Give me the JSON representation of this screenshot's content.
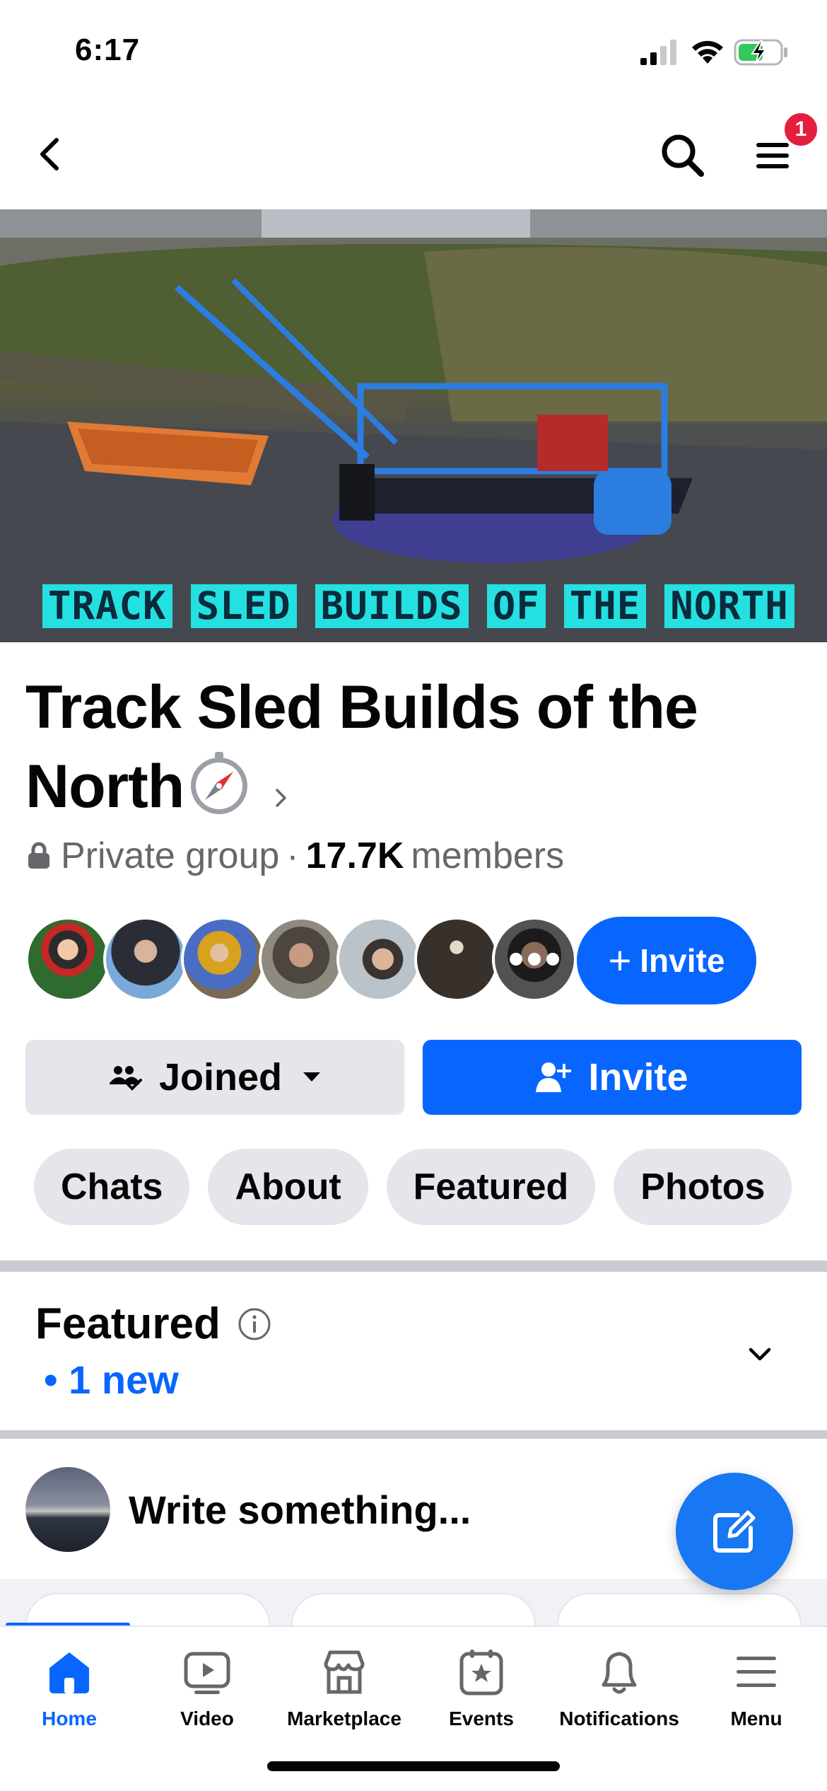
{
  "status_bar": {
    "time": "6:17",
    "icons": [
      "signal-icon",
      "wifi-icon",
      "battery-charging-icon"
    ]
  },
  "nav": {
    "icons": [
      "back-icon",
      "search-icon",
      "menu-icon"
    ],
    "menu_badge": "1"
  },
  "cover": {
    "caption_words": [
      "TRACK",
      "SLED",
      "BUILDS",
      "OF",
      "THE",
      "NORTH"
    ]
  },
  "group": {
    "title": "Track Sled Builds of the North",
    "title_emoji": "compass-icon",
    "privacy": "Private group",
    "separator": "·",
    "member_count": "17.7K",
    "members_label": "members"
  },
  "members": {
    "invite_label": "Invite"
  },
  "actions": {
    "joined_label": "Joined",
    "invite_label": "Invite"
  },
  "tabs": [
    "Chats",
    "About",
    "Featured",
    "Photos"
  ],
  "featured": {
    "title": "Featured",
    "new_label": "• 1 new"
  },
  "composer": {
    "placeholder": "Write something..."
  },
  "bottom_nav": {
    "items": [
      {
        "label": "Home",
        "icon": "home-icon",
        "active": true
      },
      {
        "label": "Video",
        "icon": "video-icon",
        "active": false
      },
      {
        "label": "Marketplace",
        "icon": "marketplace-icon",
        "active": false
      },
      {
        "label": "Events",
        "icon": "events-icon",
        "active": false
      },
      {
        "label": "Notifications",
        "icon": "bell-icon",
        "active": false
      },
      {
        "label": "Menu",
        "icon": "menu-icon",
        "active": false
      }
    ]
  },
  "colors": {
    "accent": "#0866ff",
    "badge": "#e41e3f",
    "pill_bg": "#e4e6eb",
    "muted_text": "#65676b",
    "caption_bg": "#25e0e0"
  }
}
